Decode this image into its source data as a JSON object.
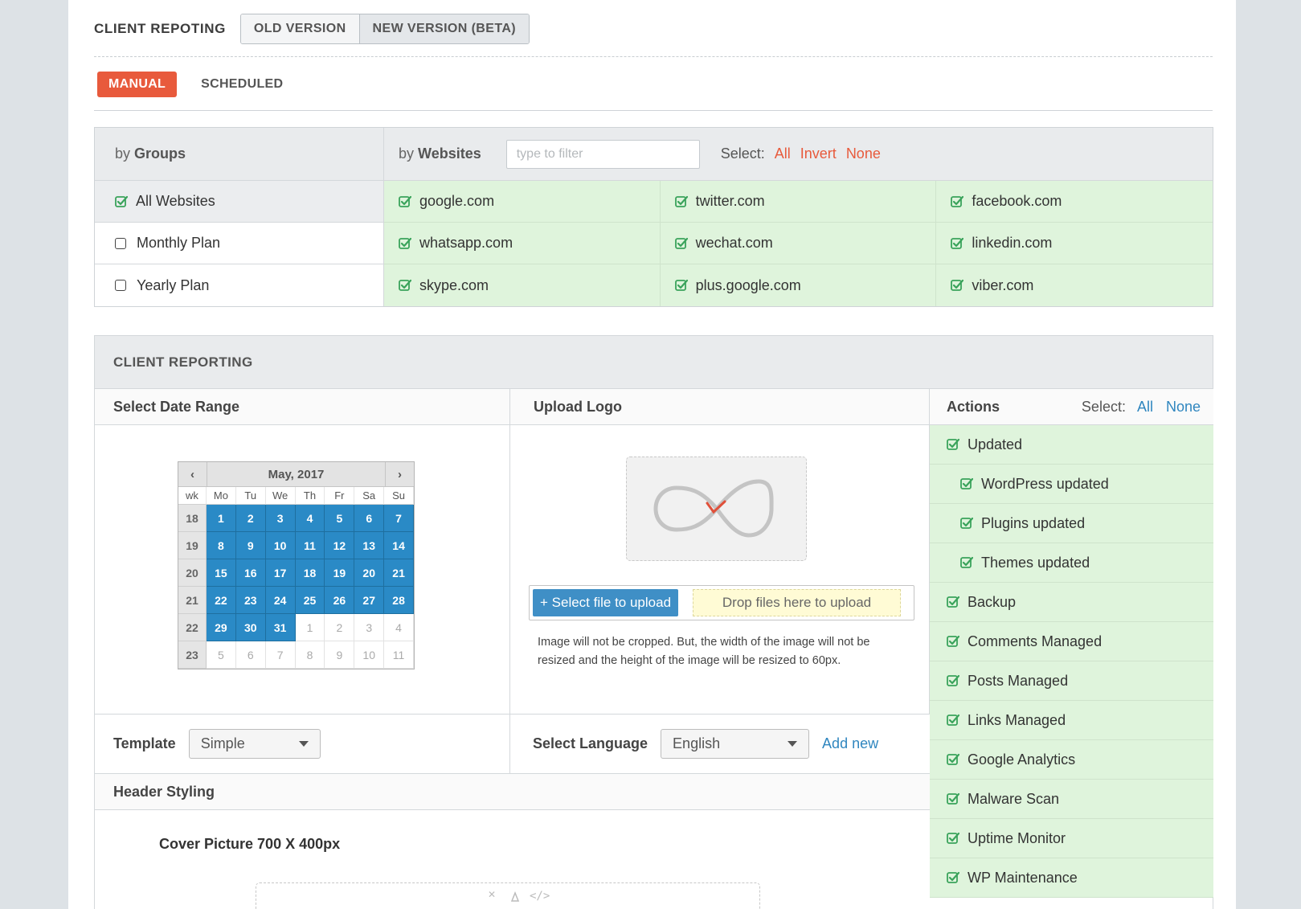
{
  "header": {
    "title": "CLIENT REPOTING",
    "old_version": "OLD VERSION",
    "new_version": "NEW VERSION (BETA)"
  },
  "modes": {
    "manual": "MANUAL",
    "scheduled": "SCHEDULED"
  },
  "selector": {
    "by": "by",
    "groups_label": "Groups",
    "websites_label": "Websites",
    "filter_placeholder": "type to filter",
    "select_label": "Select:",
    "all": "All",
    "invert": "Invert",
    "none": "None",
    "groups": [
      {
        "label": "All Websites",
        "checked": true
      },
      {
        "label": "Monthly Plan",
        "checked": false
      },
      {
        "label": "Yearly Plan",
        "checked": false
      }
    ],
    "sites": [
      "google.com",
      "twitter.com",
      "facebook.com",
      "whatsapp.com",
      "wechat.com",
      "linkedin.com",
      "skype.com",
      "plus.google.com",
      "viber.com"
    ]
  },
  "reporting": {
    "title": "CLIENT REPORTING",
    "date_range_label": "Select Date Range",
    "upload_logo_label": "Upload Logo",
    "actions_label": "Actions",
    "select_label": "Select:",
    "all": "All",
    "none": "None",
    "calendar": {
      "month": "May, 2017",
      "prev": "‹",
      "next": "›",
      "headers": [
        "wk",
        "Mo",
        "Tu",
        "We",
        "Th",
        "Fr",
        "Sa",
        "Su"
      ],
      "weeks": [
        {
          "wk": "18",
          "days": [
            "1",
            "2",
            "3",
            "4",
            "5",
            "6",
            "7"
          ],
          "in": [
            true,
            true,
            true,
            true,
            true,
            true,
            true
          ]
        },
        {
          "wk": "19",
          "days": [
            "8",
            "9",
            "10",
            "11",
            "12",
            "13",
            "14"
          ],
          "in": [
            true,
            true,
            true,
            true,
            true,
            true,
            true
          ]
        },
        {
          "wk": "20",
          "days": [
            "15",
            "16",
            "17",
            "18",
            "19",
            "20",
            "21"
          ],
          "in": [
            true,
            true,
            true,
            true,
            true,
            true,
            true
          ]
        },
        {
          "wk": "21",
          "days": [
            "22",
            "23",
            "24",
            "25",
            "26",
            "27",
            "28"
          ],
          "in": [
            true,
            true,
            true,
            true,
            true,
            true,
            true
          ]
        },
        {
          "wk": "22",
          "days": [
            "29",
            "30",
            "31",
            "1",
            "2",
            "3",
            "4"
          ],
          "in": [
            true,
            true,
            true,
            false,
            false,
            false,
            false
          ]
        },
        {
          "wk": "23",
          "days": [
            "5",
            "6",
            "7",
            "8",
            "9",
            "10",
            "11"
          ],
          "in": [
            false,
            false,
            false,
            false,
            false,
            false,
            false
          ]
        }
      ]
    },
    "upload_button": "+ Select file to upload",
    "drop_zone": "Drop files here to upload",
    "upload_note": "Image will not be cropped. But, the width of the image will not be resized and the height of the image will be resized to 60px.",
    "template_label": "Template",
    "template_value": "Simple",
    "language_label": "Select Language",
    "language_value": "English",
    "add_new": "Add new",
    "header_styling": "Header Styling",
    "cover_picture": "Cover Picture 700 X 400px",
    "actions": [
      {
        "label": "Updated",
        "sub": false
      },
      {
        "label": "WordPress updated",
        "sub": true
      },
      {
        "label": "Plugins updated",
        "sub": true
      },
      {
        "label": "Themes updated",
        "sub": true
      },
      {
        "label": "Backup",
        "sub": false
      },
      {
        "label": "Comments Managed",
        "sub": false
      },
      {
        "label": "Posts Managed",
        "sub": false
      },
      {
        "label": "Links Managed",
        "sub": false
      },
      {
        "label": "Google Analytics",
        "sub": false
      },
      {
        "label": "Malware Scan",
        "sub": false
      },
      {
        "label": "Uptime Monitor",
        "sub": false
      },
      {
        "label": "WP Maintenance",
        "sub": false
      }
    ]
  },
  "colors": {
    "accent_red": "#e85a3c",
    "link_blue": "#2f86bf",
    "check_green": "#3aa35b",
    "selected_bg": "#dff4dc",
    "calendar_blue": "#2a8ac6"
  },
  "icons": {
    "check": "checkbox-checked-icon",
    "box": "checkbox-empty-icon",
    "logo": "infinity-icon",
    "caret": "caret-down-icon"
  }
}
